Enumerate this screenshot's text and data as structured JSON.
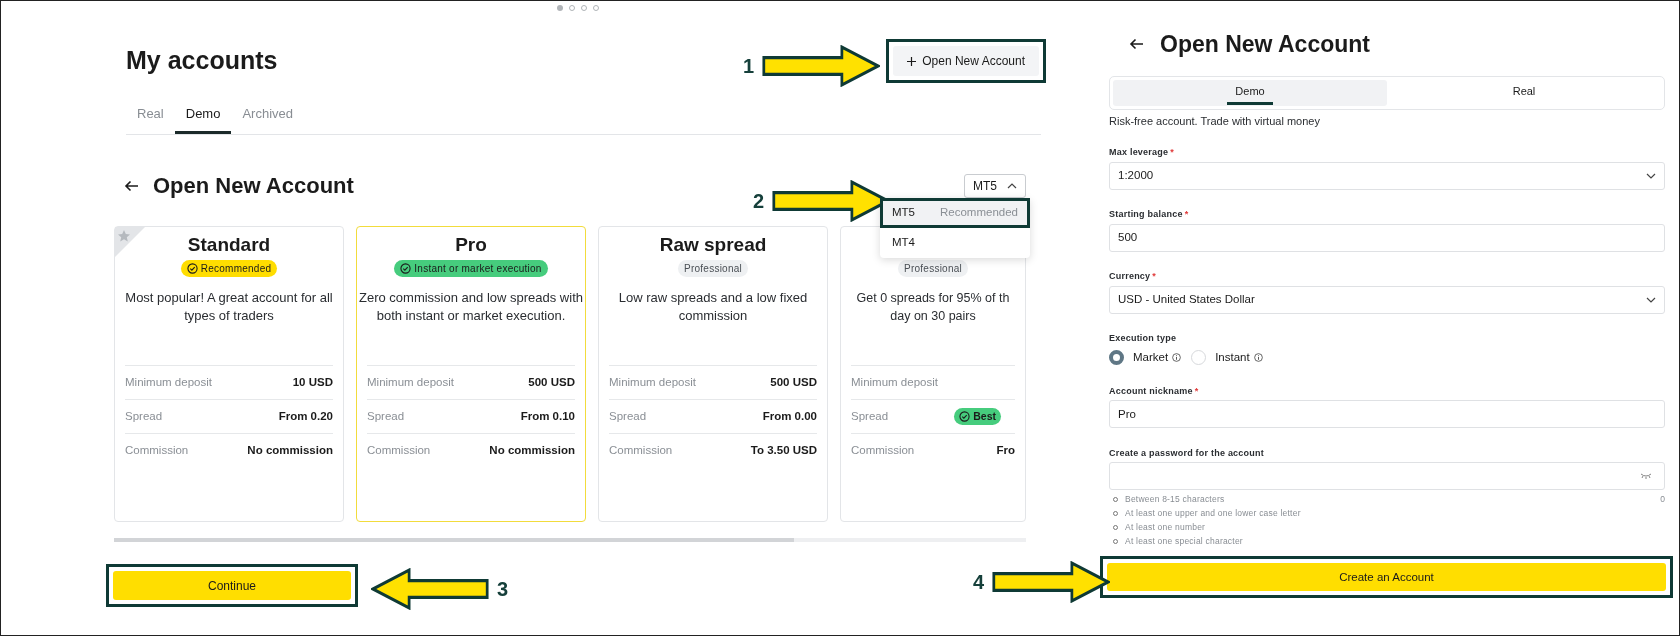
{
  "carousel_dots": [
    {
      "selected": true
    },
    {
      "selected": false
    },
    {
      "selected": false
    },
    {
      "selected": false
    }
  ],
  "accounts_page": {
    "title": "My accounts",
    "new_account_button": {
      "label": "Open New Account",
      "highlighted": true
    },
    "tabs": [
      {
        "label": "Real",
        "selected": false
      },
      {
        "label": "Demo",
        "selected": true
      },
      {
        "label": "Archived",
        "selected": false
      }
    ],
    "section_title": "Open New Account",
    "platform_select": {
      "value": "MT5",
      "expanded": true
    },
    "platform_menu": [
      {
        "label": "MT5",
        "tag": "Recommended",
        "selected": true,
        "highlighted": true
      },
      {
        "label": "MT4",
        "selected": false,
        "highlighted": false
      }
    ],
    "cards": [
      {
        "name": "Standard",
        "starred": true,
        "selected": false,
        "badge": {
          "kind": "recommended",
          "text": "Recommended"
        },
        "description": [
          "Most popular! A great account for all",
          "types of traders"
        ],
        "rows": [
          {
            "label": "Minimum deposit",
            "value": "10 USD",
            "kind": "text"
          },
          {
            "label": "Spread",
            "value": "From 0.20",
            "kind": "text"
          },
          {
            "label": "Commission",
            "value": "No commission",
            "kind": "text"
          }
        ]
      },
      {
        "name": "Pro",
        "starred": false,
        "selected": true,
        "badge": {
          "kind": "execution",
          "text": "Instant or market execution"
        },
        "description": [
          "Zero commission and low spreads with",
          "both instant or market execution."
        ],
        "rows": [
          {
            "label": "Minimum deposit",
            "value": "500 USD",
            "kind": "text"
          },
          {
            "label": "Spread",
            "value": "From 0.10",
            "kind": "text"
          },
          {
            "label": "Commission",
            "value": "No commission",
            "kind": "text"
          }
        ]
      },
      {
        "name": "Raw spread",
        "starred": false,
        "selected": false,
        "badge": {
          "kind": "professional",
          "text": "Professional"
        },
        "description": [
          "Low raw spreads and a low fixed",
          "commission"
        ],
        "rows": [
          {
            "label": "Minimum deposit",
            "value": "500 USD",
            "kind": "text"
          },
          {
            "label": "Spread",
            "value": "From 0.00",
            "kind": "text"
          },
          {
            "label": "Commission",
            "value": "To 3.50 USD",
            "kind": "text"
          }
        ]
      },
      {
        "starred": false,
        "selected": false,
        "badge": {
          "kind": "professional",
          "text": "Professional"
        },
        "description": [
          "Get 0 spreads for 95% of th",
          "day on 30 pairs"
        ],
        "rows": [
          {
            "label": "Minimum deposit"
          },
          {
            "label": "Spread",
            "value": "Best",
            "kind": "badge"
          },
          {
            "label": "Commission",
            "value": "Fro",
            "kind": "text"
          }
        ]
      }
    ],
    "continue_button": {
      "label": "Continue",
      "highlighted": true
    }
  },
  "form_panel": {
    "title": "Open New Account",
    "mode_tabs": [
      {
        "label": "Demo",
        "selected": true
      },
      {
        "label": "Real",
        "selected": false
      }
    ],
    "mode_hint": "Risk-free account. Trade with virtual money",
    "fields": [
      {
        "kind": "select",
        "label": "Max leverage",
        "required_mark": "*",
        "value": "1:2000"
      },
      {
        "kind": "text",
        "label": "Starting balance",
        "required_mark": "*",
        "value": "500"
      },
      {
        "kind": "select",
        "label": "Currency",
        "required_mark": "*",
        "value": "USD - United States Dollar"
      },
      {
        "kind": "radio",
        "label": "Execution type",
        "options": [
          {
            "label": "Market",
            "selected": true
          },
          {
            "label": "Instant",
            "selected": false
          }
        ]
      },
      {
        "kind": "text",
        "label": "Account nickname",
        "required_mark": "*",
        "value": "Pro"
      },
      {
        "kind": "password",
        "label": "Create a password for the account",
        "counter": "0",
        "rules": [
          "Between 8-15 characters",
          "At least one upper and one lower case letter",
          "At least one number",
          "At least one special character"
        ]
      }
    ],
    "create_button": {
      "label": "Create an Account",
      "highlighted": true
    }
  },
  "callouts": [
    {
      "number": "1"
    },
    {
      "number": "2"
    },
    {
      "number": "3"
    },
    {
      "number": "4"
    }
  ]
}
